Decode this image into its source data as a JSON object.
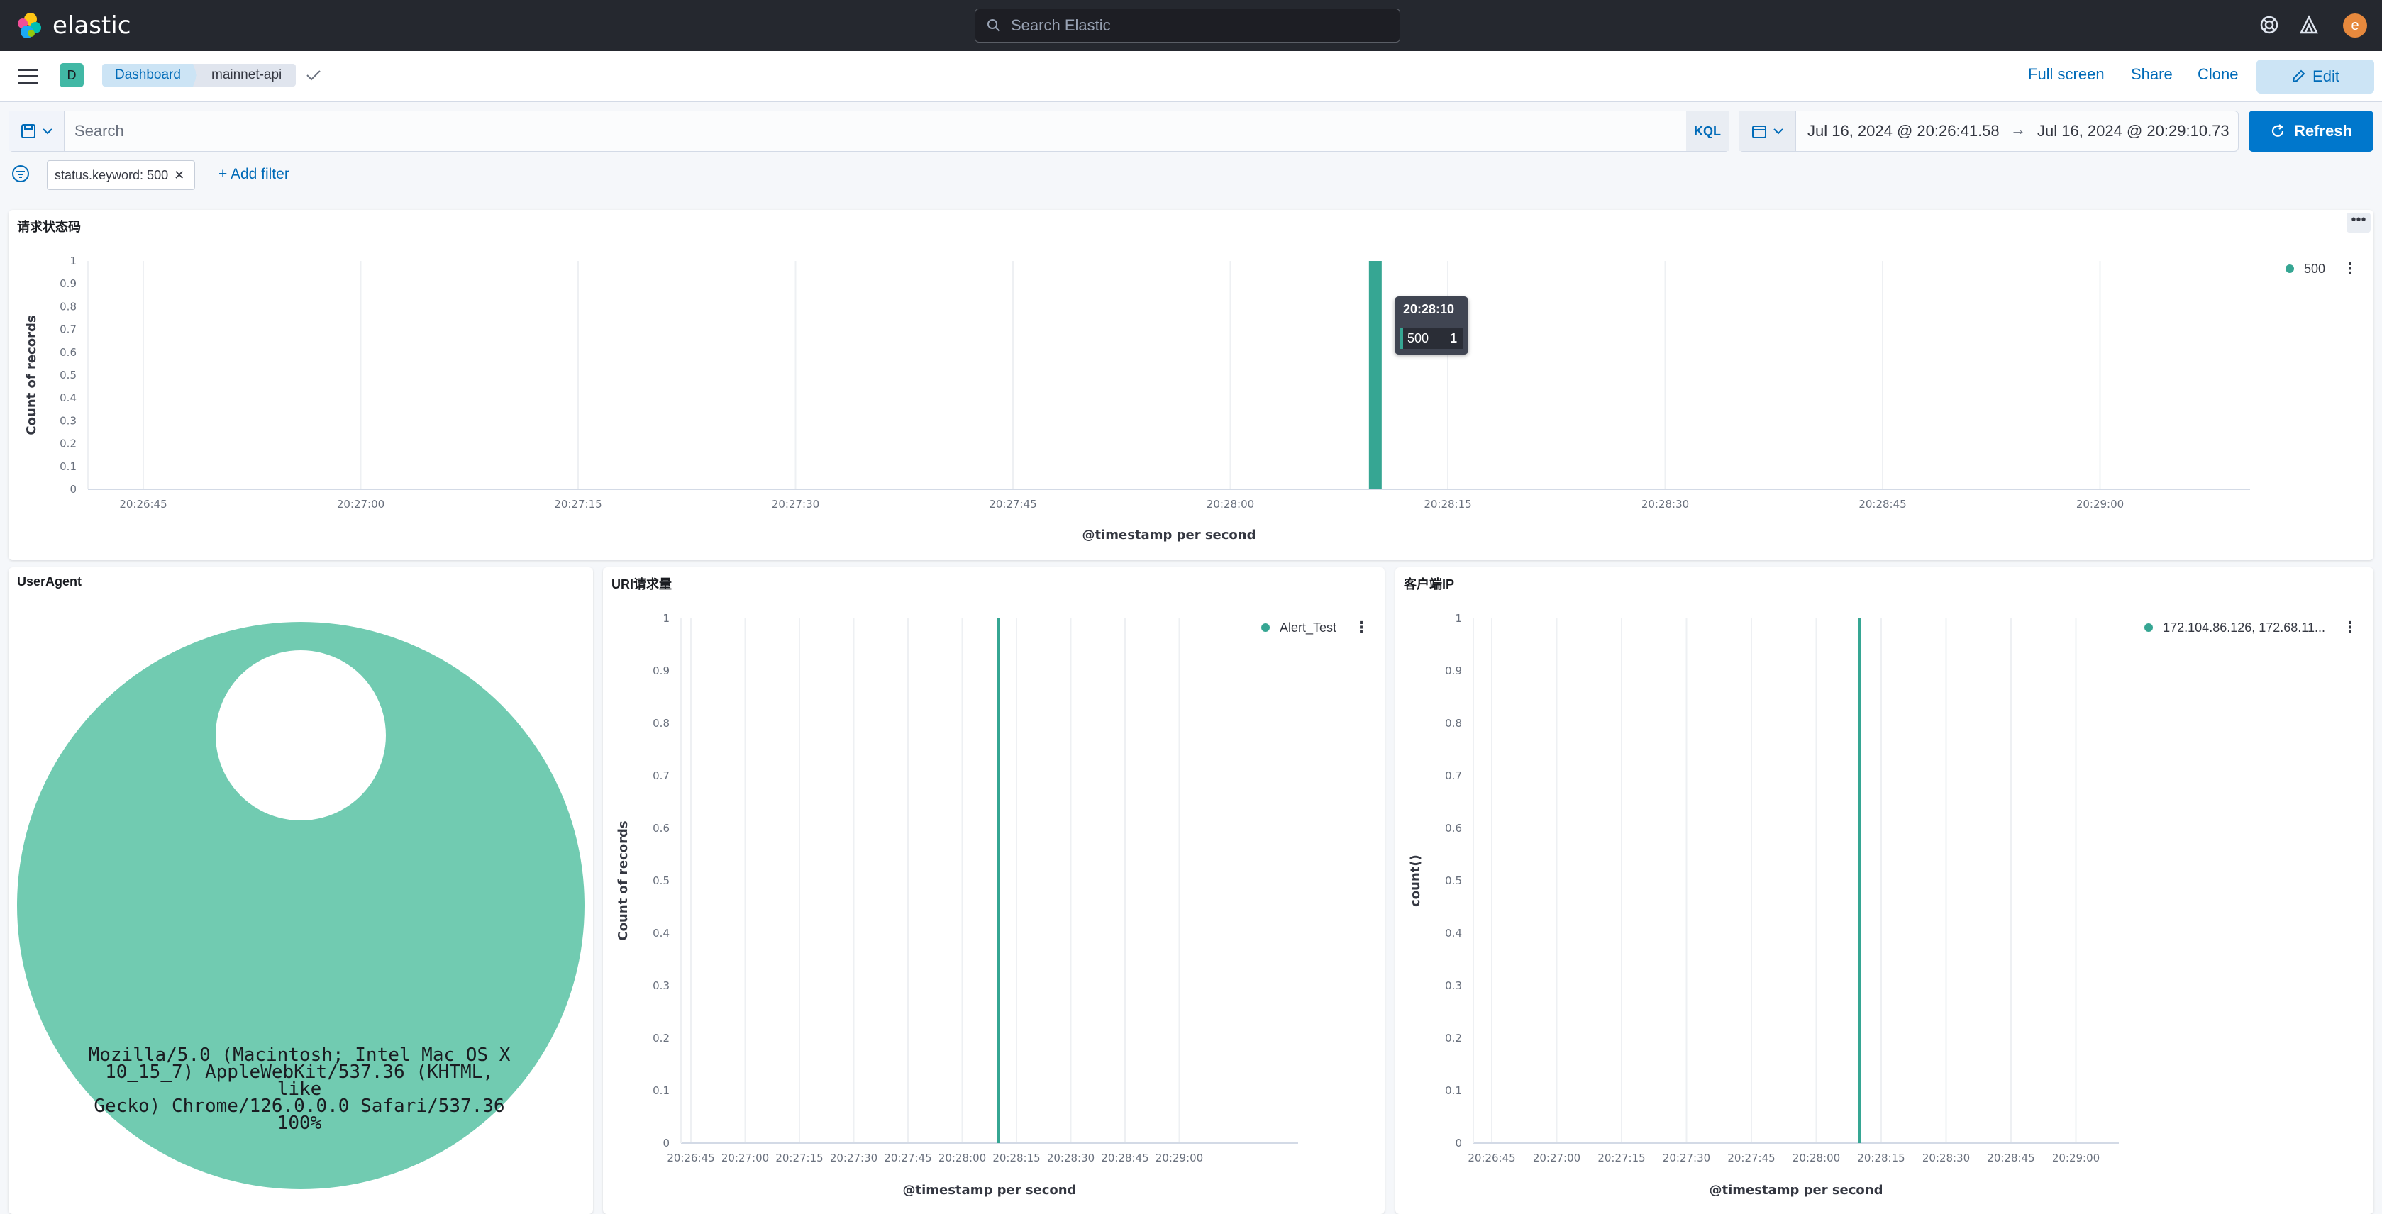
{
  "header": {
    "brand": "elastic",
    "search_placeholder": "Search Elastic",
    "avatar_letter": "e"
  },
  "toolbar": {
    "space_badge": "D",
    "breadcrumb_dashboard": "Dashboard",
    "breadcrumb_current": "mainnet-api",
    "full_screen": "Full screen",
    "share": "Share",
    "clone": "Clone",
    "edit": "Edit"
  },
  "query": {
    "placeholder": "Search",
    "language": "KQL",
    "time_start": "Jul 16, 2024 @ 20:26:41.58",
    "time_end": "Jul 16, 2024 @ 20:29:10.73",
    "refresh": "Refresh",
    "filter_pill": "status.keyword: 500",
    "add_filter": "+ Add filter"
  },
  "colors": {
    "series": "#36a693",
    "donut": "#71cbb1",
    "accent": "#0077cc"
  },
  "panels": {
    "status": {
      "title": "请求状态码",
      "legend": "500",
      "tooltip_time": "20:28:10",
      "tooltip_series": "500",
      "tooltip_value": "1"
    },
    "useragent": {
      "title": "UserAgent",
      "label_lines": [
        "Mozilla/5.0 (Macintosh; Intel Mac OS X",
        "10_15_7) AppleWebKit/537.36 (KHTML, like",
        "Gecko) Chrome/126.0.0.0 Safari/537.36",
        "100%"
      ]
    },
    "uri": {
      "title": "URI请求量",
      "legend": "Alert_Test"
    },
    "clientip": {
      "title": "客户端IP",
      "legend": "172.104.86.126, 172.68.11..."
    }
  },
  "chart_data": [
    {
      "type": "bar",
      "title": "请求状态码",
      "xlabel": "@timestamp per second",
      "ylabel": "Count of records",
      "x_ticks": [
        "20:26:45",
        "20:27:00",
        "20:27:15",
        "20:27:30",
        "20:27:45",
        "20:28:00",
        "20:28:15",
        "20:28:30",
        "20:28:45",
        "20:29:00"
      ],
      "y_ticks": [
        "0",
        "0.1",
        "0.2",
        "0.3",
        "0.4",
        "0.5",
        "0.6",
        "0.7",
        "0.8",
        "0.9",
        "1"
      ],
      "ylim": [
        0,
        1
      ],
      "series": [
        {
          "name": "500",
          "points": [
            {
              "x": "20:28:10",
              "y": 1
            }
          ]
        }
      ],
      "legend": "top-right"
    },
    {
      "type": "pie",
      "title": "UserAgent",
      "slices": [
        {
          "label": "Mozilla/5.0 (Macintosh; Intel Mac OS X 10_15_7) AppleWebKit/537.36 (KHTML, like Gecko) Chrome/126.0.0.0 Safari/537.36",
          "value": 100
        }
      ]
    },
    {
      "type": "bar",
      "title": "URI请求量",
      "xlabel": "@timestamp per second",
      "ylabel": "Count of records",
      "x_ticks": [
        "20:26:45",
        "20:27:00",
        "20:27:15",
        "20:27:30",
        "20:27:45",
        "20:28:00",
        "20:28:15",
        "20:28:30",
        "20:28:45",
        "20:29:00"
      ],
      "y_ticks": [
        "0",
        "0.1",
        "0.2",
        "0.3",
        "0.4",
        "0.5",
        "0.6",
        "0.7",
        "0.8",
        "0.9",
        "1"
      ],
      "ylim": [
        0,
        1
      ],
      "series": [
        {
          "name": "Alert_Test",
          "points": [
            {
              "x": "20:28:10",
              "y": 1
            }
          ]
        }
      ],
      "legend": "top-right"
    },
    {
      "type": "bar",
      "title": "客户端IP",
      "xlabel": "@timestamp per second",
      "ylabel": "count()",
      "x_ticks": [
        "20:26:45",
        "20:27:00",
        "20:27:15",
        "20:27:30",
        "20:27:45",
        "20:28:00",
        "20:28:15",
        "20:28:30",
        "20:28:45",
        "20:29:00"
      ],
      "y_ticks": [
        "0",
        "0.1",
        "0.2",
        "0.3",
        "0.4",
        "0.5",
        "0.6",
        "0.7",
        "0.8",
        "0.9",
        "1"
      ],
      "ylim": [
        0,
        1
      ],
      "series": [
        {
          "name": "172.104.86.126, 172.68.11...",
          "points": [
            {
              "x": "20:28:10",
              "y": 1
            }
          ]
        }
      ],
      "legend": "top-right"
    }
  ]
}
